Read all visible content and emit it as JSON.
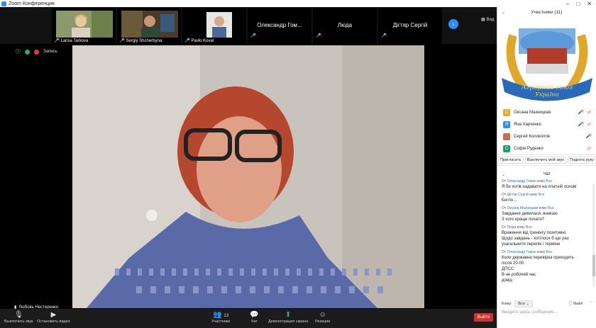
{
  "window": {
    "title": "Zoom Конференция"
  },
  "strip": {
    "tiles": [
      {
        "name": "Larisa Tarkova",
        "muted": true
      },
      {
        "name": "Sergiy Shcherbyna",
        "muted": true
      },
      {
        "name": "Pavlo Koval",
        "muted": true
      },
      {
        "name": "Олександр  Гом...",
        "muted": true
      },
      {
        "name": "Люда",
        "muted": true
      },
      {
        "name": "Дігтяр Сергій",
        "muted": true
      }
    ],
    "view_label": "Вид"
  },
  "meeting": {
    "recording_label": "Запись",
    "speaker": "Любовь Нестеренко"
  },
  "toolbar": {
    "mute": "Выключить звук",
    "video": "Остановить видео",
    "participants": "Участники",
    "participants_count": "13",
    "chat": "Чат",
    "share": "Демонстрация экрана",
    "reactions": "Реакции",
    "leave": "Выйти"
  },
  "participants_panel": {
    "title": "Участники (11)",
    "logo_text_line1": "Аграрний союз",
    "logo_text_line2": "України",
    "list": [
      {
        "initial": "О",
        "name": "Оксана Мазницкая",
        "color": "#e8a62b"
      },
      {
        "initial": "Я",
        "name": "Яна Харченко",
        "color": "#2d8cff"
      },
      {
        "initial": "",
        "name": "Сергей Колоколов",
        "color": "#c96f4a"
      },
      {
        "initial": "С",
        "name": "Софія Руденко",
        "color": "#1e9e6a"
      }
    ],
    "buttons": [
      "Пригласить",
      "Выключить мой звук",
      "Поднять руку"
    ]
  },
  "chat": {
    "title": "Чат",
    "messages": [
      {
        "from": "Олександр Гоман",
        "to": "Все",
        "text": "Я би хотів надавати на платній основі"
      },
      {
        "from": "Дігтяр Сергій",
        "to": "Все",
        "text": "Бегло..."
      },
      {
        "from": "Оксана Мазницкая",
        "to": "Все",
        "text": "Завдання дивилася, вникаю\nЗ чого краще почати?"
      },
      {
        "from": "Люда",
        "to": "Все",
        "text": "Враження від тренінгу позитивні.\nЩодо завдань - хотілося б ще раз\nузагальнити перелік і терміни"
      },
      {
        "from": "Олександр Гоман",
        "to": "Все",
        "text": "Коли державна перевірка приходить\nпісля 20-00\nДПСС\nВ не робочий час\nдовід"
      }
    ],
    "from_prefix": "От",
    "to_word": "кому",
    "send_to_label": "Кому:",
    "send_to_value": "Все",
    "file_label": "Файл",
    "placeholder": "Введите здесь сообщение..."
  }
}
